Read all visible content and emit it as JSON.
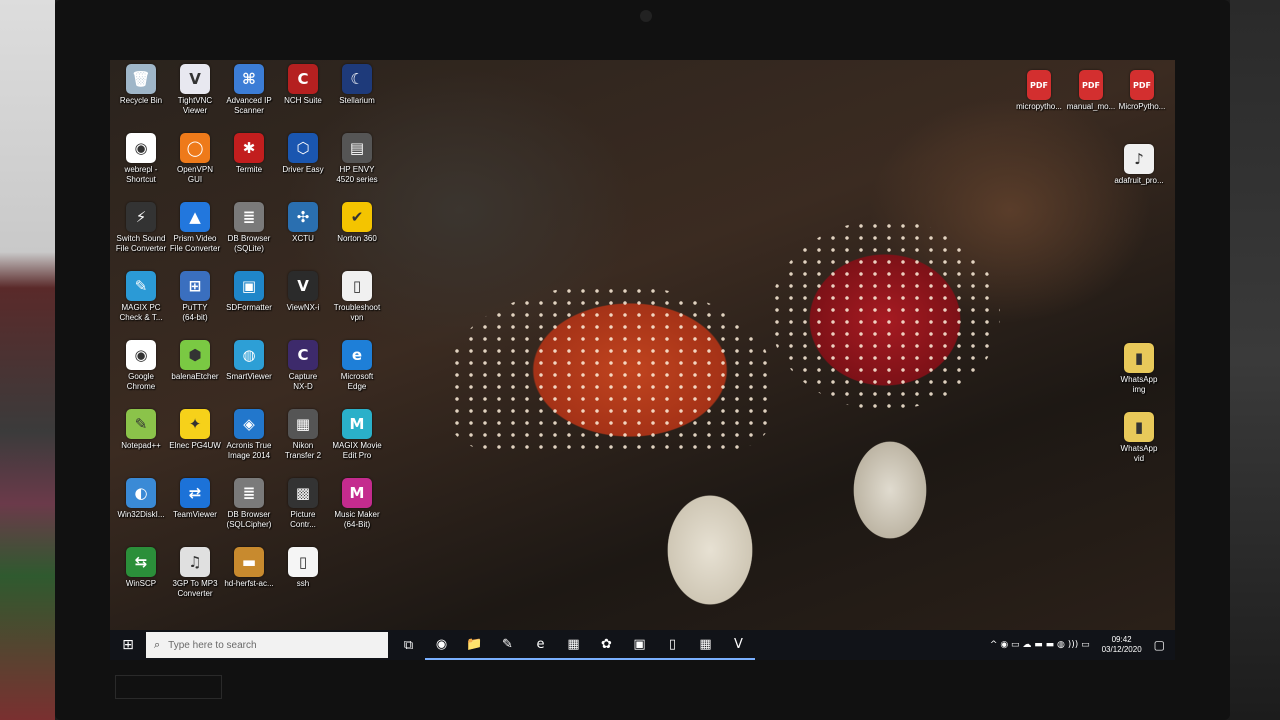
{
  "desktop": {
    "icons": [
      {
        "label": "Recycle Bin",
        "color": "#9fb6c8",
        "glyph": "🗑"
      },
      {
        "label": "TightVNC\nViewer",
        "color": "#e8e8f0",
        "glyph": "V"
      },
      {
        "label": "Advanced IP\nScanner",
        "color": "#3c7dd6",
        "glyph": "⌘"
      },
      {
        "label": "NCH Suite",
        "color": "#b52020",
        "glyph": "C"
      },
      {
        "label": "Stellarium",
        "color": "#1e3a7a",
        "glyph": "☾"
      },
      {
        "label": "webrepl -\nShortcut",
        "color": "#ffffff",
        "glyph": "◉"
      },
      {
        "label": "OpenVPN\nGUI",
        "color": "#ee7a1a",
        "glyph": "◯"
      },
      {
        "label": "Termite",
        "color": "#c21e1e",
        "glyph": "✱"
      },
      {
        "label": "Driver Easy",
        "color": "#1a56b0",
        "glyph": "⬡"
      },
      {
        "label": "HP ENVY\n4520 series",
        "color": "#555555",
        "glyph": "▤"
      },
      {
        "label": "Switch Sound\nFile Converter",
        "color": "#333333",
        "glyph": "⚡"
      },
      {
        "label": "Prism Video\nFile Converter",
        "color": "#2277dd",
        "glyph": "▲"
      },
      {
        "label": "DB Browser\n(SQLite)",
        "color": "#7a7a7a",
        "glyph": "≣"
      },
      {
        "label": "XCTU",
        "color": "#2a6fb0",
        "glyph": "✣"
      },
      {
        "label": "Norton 360",
        "color": "#f4c400",
        "glyph": "✔"
      },
      {
        "label": "MAGIX PC\nCheck & T...",
        "color": "#2b9ad6",
        "glyph": "✎"
      },
      {
        "label": "PuTTY\n(64-bit)",
        "color": "#3a6fbf",
        "glyph": "⊞"
      },
      {
        "label": "SDFormatter",
        "color": "#1f86c9",
        "glyph": "▣"
      },
      {
        "label": "ViewNX-i",
        "color": "#2b2b2b",
        "glyph": "V"
      },
      {
        "label": "Troubleshoot\nvpn",
        "color": "#f0f0f0",
        "glyph": "▯"
      },
      {
        "label": "Google\nChrome",
        "color": "#ffffff",
        "glyph": "◉"
      },
      {
        "label": "balenaEtcher",
        "color": "#7ac943",
        "glyph": "⬢"
      },
      {
        "label": "SmartViewer",
        "color": "#2d9fd6",
        "glyph": "◍"
      },
      {
        "label": "Capture\nNX-D",
        "color": "#3d2a6b",
        "glyph": "C"
      },
      {
        "label": "Microsoft\nEdge",
        "color": "#1e7fd8",
        "glyph": "e"
      },
      {
        "label": "Notepad++",
        "color": "#8bc34a",
        "glyph": "✎"
      },
      {
        "label": "Elnec PG4UW",
        "color": "#f6d11a",
        "glyph": "✦"
      },
      {
        "label": "Acronis True\nImage 2014",
        "color": "#2277cc",
        "glyph": "◈"
      },
      {
        "label": "Nikon\nTransfer 2",
        "color": "#555555",
        "glyph": "▦"
      },
      {
        "label": "MAGIX Movie\nEdit Pro",
        "color": "#2ab0c9",
        "glyph": "M"
      },
      {
        "label": "Win32DiskI...",
        "color": "#3a8ad6",
        "glyph": "◐"
      },
      {
        "label": "TeamViewer",
        "color": "#1c72d8",
        "glyph": "⇄"
      },
      {
        "label": "DB Browser\n(SQLCipher)",
        "color": "#7a7a7a",
        "glyph": "≣"
      },
      {
        "label": "Picture\nContr...",
        "color": "#333333",
        "glyph": "▩"
      },
      {
        "label": "Music Maker\n(64-Bit)",
        "color": "#c42b8e",
        "glyph": "M"
      },
      {
        "label": "WinSCP",
        "color": "#2b8f3a",
        "glyph": "⇆"
      },
      {
        "label": "3GP To MP3\nConverter",
        "color": "#e0e0e0",
        "glyph": "♫"
      },
      {
        "label": "hd-herfst-ac...",
        "color": "#c88a2e",
        "glyph": "▬"
      },
      {
        "label": "ssh",
        "color": "#f5f5f5",
        "glyph": "▯"
      }
    ],
    "right_icons": [
      {
        "label": "micropytho...",
        "color": "#d32f2f",
        "glyph": "PDF"
      },
      {
        "label": "manual_mo...",
        "color": "#d32f2f",
        "glyph": "PDF"
      },
      {
        "label": "MicroPytho...",
        "color": "#d32f2f",
        "glyph": "PDF"
      },
      {
        "label": "adafruit_pro...",
        "color": "#f0f0f0",
        "glyph": "♪"
      },
      {
        "label": "WhatsApp\nimg",
        "color": "#e8c95a",
        "glyph": "▮"
      },
      {
        "label": "WhatsApp\nvid",
        "color": "#e8c95a",
        "glyph": "▮"
      }
    ]
  },
  "taskbar": {
    "search_placeholder": "Type here to search",
    "start_glyph": "⊞",
    "pinned": [
      {
        "name": "task-view",
        "glyph": "⧉"
      },
      {
        "name": "chrome",
        "glyph": "◉"
      },
      {
        "name": "file-explorer",
        "glyph": "📁"
      },
      {
        "name": "notepadpp",
        "glyph": "✎"
      },
      {
        "name": "edge",
        "glyph": "e"
      },
      {
        "name": "app-5",
        "glyph": "▦"
      },
      {
        "name": "app-6",
        "glyph": "✿"
      },
      {
        "name": "app-7",
        "glyph": "▣"
      },
      {
        "name": "app-8",
        "glyph": "▯"
      },
      {
        "name": "app-9",
        "glyph": "▦"
      },
      {
        "name": "magix",
        "glyph": "V"
      }
    ],
    "tray_glyphs": "^ ◉ ▭ ☁ ▬ ▬ ◍ ))) ▭",
    "time": "09:42",
    "date": "03/12/2020",
    "notification_glyph": "▢"
  }
}
